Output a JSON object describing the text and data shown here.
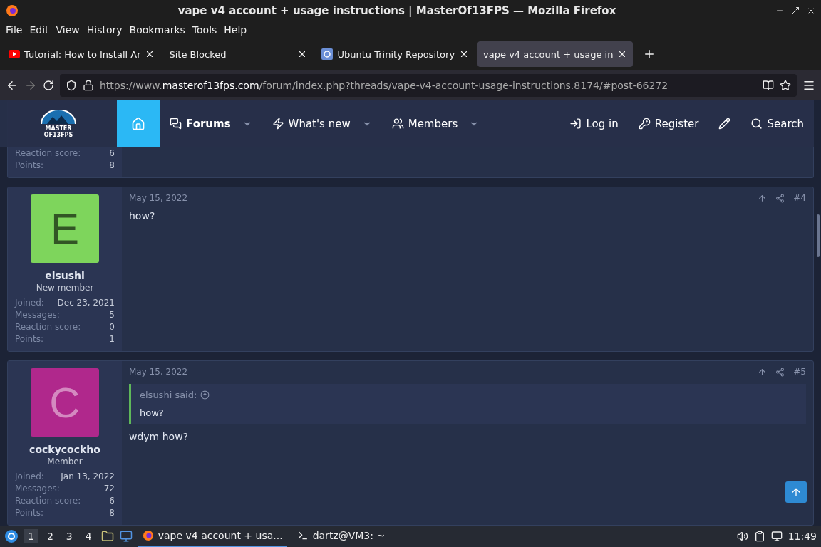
{
  "window": {
    "title": "vape v4 account + usage instructions | MasterOf13FPS — Mozilla Firefox"
  },
  "menu": [
    "File",
    "Edit",
    "View",
    "History",
    "Bookmarks",
    "Tools",
    "Help"
  ],
  "tabs": [
    {
      "label": "Tutorial: How to Install Ar",
      "kind": "video",
      "selected": false
    },
    {
      "label": "Site Blocked",
      "kind": "plain",
      "selected": false
    },
    {
      "label": "Ubuntu Trinity Repository",
      "kind": "repo",
      "selected": false
    },
    {
      "label": "vape v4 account + usage in",
      "kind": "plain",
      "selected": true
    }
  ],
  "url": {
    "prefix": "https://www.",
    "domain": "masterof13fps.com",
    "path": "/forum/index.php?threads/vape-v4-account-usage-instructions.8174/#post-66272"
  },
  "logo": {
    "line1": "MASTER",
    "line2": "OF13FPS"
  },
  "nav": [
    {
      "kind": "home",
      "selected": true
    },
    {
      "kind": "forums",
      "label": "Forums",
      "selected": false
    },
    {
      "kind": "new",
      "label": "What's new",
      "selected": false
    },
    {
      "kind": "members",
      "label": "Members",
      "selected": false
    }
  ],
  "nav_right": [
    {
      "kind": "login",
      "label": "Log in"
    },
    {
      "kind": "register",
      "label": "Register"
    },
    {
      "kind": "edit"
    },
    {
      "kind": "search",
      "label": "Search"
    }
  ],
  "partial_post": {
    "stats": [
      {
        "label": "Reaction score:",
        "value": "6"
      },
      {
        "label": "Points:",
        "value": "8"
      }
    ]
  },
  "posts": [
    {
      "letter": "E",
      "color": "#7ed55c",
      "username": "elsushi",
      "role": "New member",
      "stats": [
        {
          "label": "Joined:",
          "value": "Dec 23, 2021"
        },
        {
          "label": "Messages:",
          "value": "5"
        },
        {
          "label": "Reaction score:",
          "value": "0"
        },
        {
          "label": "Points:",
          "value": "1"
        }
      ],
      "date": "May 15, 2022",
      "number": "#4",
      "body": "how?"
    },
    {
      "letter": "C",
      "color": "#b0288c",
      "username": "cockycockho",
      "role": "Member",
      "stats": [
        {
          "label": "Joined:",
          "value": "Jan 13, 2022"
        },
        {
          "label": "Messages:",
          "value": "72"
        },
        {
          "label": "Reaction score:",
          "value": "6"
        },
        {
          "label": "Points:",
          "value": "8"
        }
      ],
      "date": "May 15, 2022",
      "number": "#5",
      "quote": {
        "author": "elsushi said:",
        "text": "how?"
      },
      "body": "wdym how?"
    }
  ],
  "taskbar": {
    "workspaces": [
      {
        "label": "1",
        "selected": true
      },
      {
        "label": "2",
        "selected": false
      },
      {
        "label": "3",
        "selected": false
      },
      {
        "label": "4",
        "selected": false
      }
    ],
    "tasks": [
      {
        "kind": "browser",
        "label": "vape v4 account + usa...",
        "selected": true
      },
      {
        "kind": "terminal",
        "label": "dartz@VM3: ~",
        "selected": false
      }
    ],
    "clock": "11:49"
  }
}
